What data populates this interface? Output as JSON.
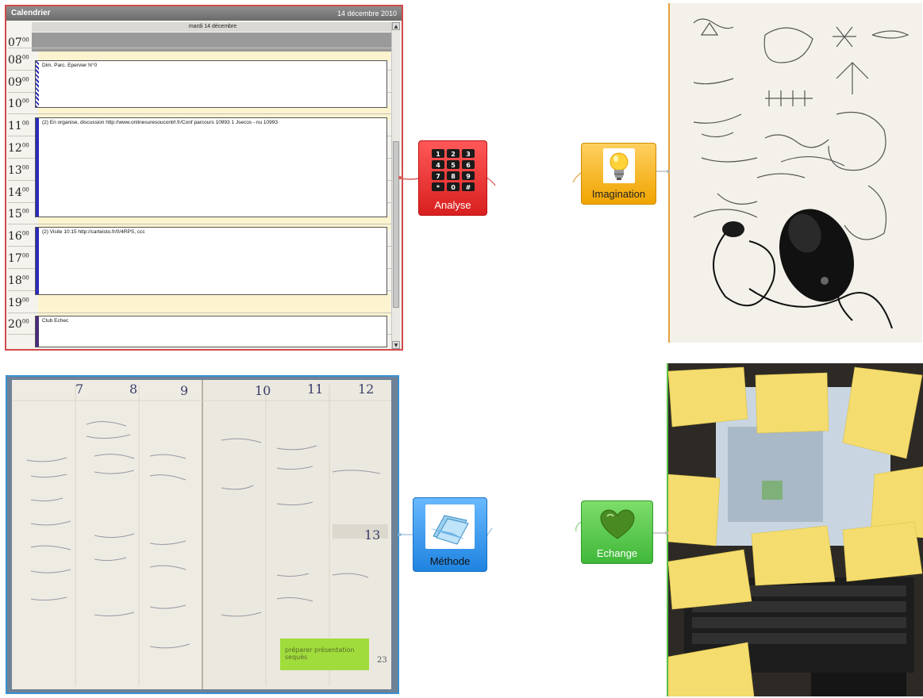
{
  "calendar": {
    "title": "Calendrier",
    "date": "14 décembre 2010",
    "day_header": "mardi 14 décembre",
    "hours": [
      {
        "h": "07",
        "m": "00"
      },
      {
        "h": "08",
        "m": "00"
      },
      {
        "h": "09",
        "m": "00"
      },
      {
        "h": "10",
        "m": "00"
      },
      {
        "h": "11",
        "m": "00"
      },
      {
        "h": "12",
        "m": "00"
      },
      {
        "h": "13",
        "m": "00"
      },
      {
        "h": "14",
        "m": "00"
      },
      {
        "h": "15",
        "m": "00"
      },
      {
        "h": "16",
        "m": "00"
      },
      {
        "h": "17",
        "m": "00"
      },
      {
        "h": "18",
        "m": "00"
      },
      {
        "h": "19",
        "m": "00"
      },
      {
        "h": "20",
        "m": "00"
      }
    ],
    "events": [
      "Dim. Parc. Epervier N°0",
      "(2) En organise, discussion http://www.onlinesuresoucontrl.fr/Conf parcours 10993 1 Jsecos - nu 10993",
      "(2) Visite 10:15 http://carteisto.fr/0/4RPS, ccc",
      "Club Echec"
    ]
  },
  "nodes": {
    "analyse": {
      "label": "Analyse",
      "color": "#e02828"
    },
    "imagination": {
      "label": "Imagination",
      "color": "#f5b317"
    },
    "methode": {
      "label": "Méthode",
      "color": "#2a8ce8"
    },
    "echange": {
      "label": "Echange",
      "color": "#4cbf3e"
    }
  },
  "planner": {
    "dates": [
      "7",
      "8",
      "9",
      "10",
      "11",
      "12",
      "13"
    ],
    "page_number": "23",
    "sticky_note": "préparer présentation sequès"
  },
  "icons": {
    "analyse": "calculator-keypad-icon",
    "imagination": "light-bulb-icon",
    "methode": "folder-icon",
    "echange": "heart-icon"
  }
}
